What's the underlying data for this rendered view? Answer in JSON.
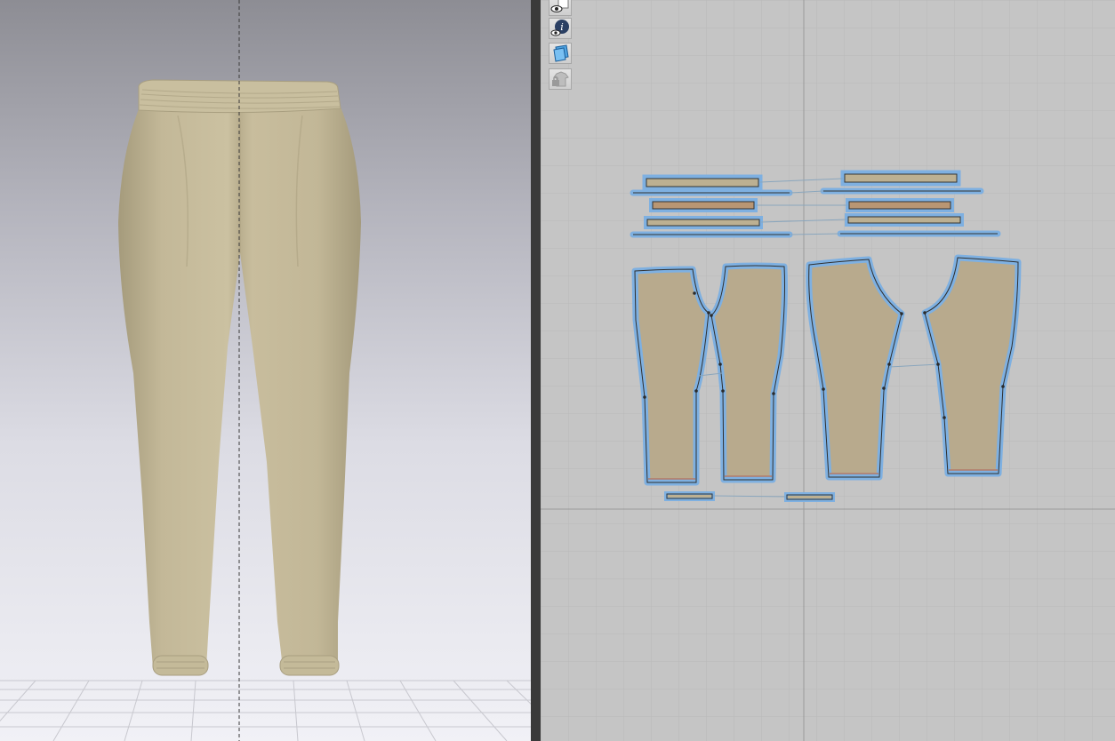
{
  "app": {
    "window_title": ""
  },
  "toolbar_2d": {
    "items": [
      {
        "name": "show-pattern",
        "icon": "eye-shirt-icon"
      },
      {
        "name": "show-info",
        "icon": "eye-info-icon"
      },
      {
        "name": "show-texture",
        "icon": "eye-texture-icon"
      },
      {
        "name": "lock-pattern",
        "icon": "lock-garment-icon"
      }
    ]
  },
  "colors": {
    "fabric_3d": "#c2b796",
    "fabric_2d": "#b8aa8d",
    "band_2d": "#b99673",
    "outline_selected": "#7eb0e1",
    "grid_2d": "#b9b9b9",
    "background_2d": "#c5c5c5"
  }
}
